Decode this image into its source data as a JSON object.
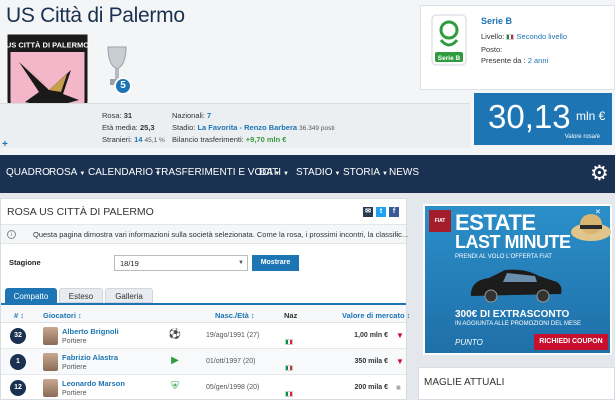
{
  "club": {
    "name": "US Città di Palermo",
    "crest_text": "US CITTÀ DI PALERMO",
    "trophy_count": "5"
  },
  "stats": {
    "squad_label": "Rosa:",
    "squad_value": "31",
    "age_label": "Età media:",
    "age_value": "25,3",
    "foreign_label": "Stranieri:",
    "foreign_value": "14",
    "foreign_pct": "45,1 %",
    "national_label": "Nazionali:",
    "national_value": "7",
    "stadium_label": "Stadio:",
    "stadium_value": "La Favorita - Renzo Barbera",
    "stadium_seats": "36.349 posti",
    "balance_label": "Bilancio trasferimenti:",
    "balance_value": "+9,70 mln €"
  },
  "league": {
    "name": "Serie B",
    "logo_text": "Serie B",
    "level_label": "Livello:",
    "level_value": "Secondo livello",
    "position_label": "Posto:",
    "since_label": "Presente da :",
    "since_value": "2 anni"
  },
  "market_value": {
    "amount": "30,13",
    "unit": "mln €",
    "label": "Valore rosa/e"
  },
  "nav": {
    "items": [
      {
        "label": "QUADRO",
        "caret": false
      },
      {
        "label": "ROSA",
        "caret": true
      },
      {
        "label": "CALENDARIO",
        "caret": true
      },
      {
        "label": "TRASFERIMENTI E VOCI",
        "caret": true
      },
      {
        "label": "DATI",
        "caret": true
      },
      {
        "label": "STADIO",
        "caret": true
      },
      {
        "label": "STORIA",
        "caret": true
      },
      {
        "label": "NEWS",
        "caret": false
      }
    ],
    "gear_icon": "gear-icon"
  },
  "squad": {
    "title": "ROSA US CITTÀ DI PALERMO",
    "info_text": "Questa pagina dimostra vari informazioni sulla società selezionata. Come la rosa, i prossimi incontri, la classific...",
    "season_label": "Stagione",
    "season_value": "18/19",
    "show_button": "Mostrare",
    "tabs": [
      "Compatto",
      "Esteso",
      "Galleria"
    ],
    "headers": {
      "num": "#",
      "player": "Giocatori",
      "birth": "Nasc./Età",
      "nat": "Naz",
      "value": "Valore di mercato"
    },
    "players": [
      {
        "num": "32",
        "name": "Alberto Brignoli",
        "position": "Portiere",
        "birth": "19/ago/1991 (27)",
        "value": "1,00 mln €",
        "trend": "down"
      },
      {
        "num": "1",
        "name": "Fabrizio Alastra",
        "position": "Portiere",
        "birth": "01/ott/1997 (20)",
        "value": "350 mila €",
        "trend": "down"
      },
      {
        "num": "12",
        "name": "Leonardo Marson",
        "position": "Portiere",
        "birth": "05/gen/1998 (20)",
        "value": "200 mila €",
        "trend": "neutral"
      }
    ]
  },
  "ad": {
    "brand": "FIAT",
    "title1": "ESTATE",
    "title2": "LAST MINUTE",
    "subtitle": "PRENDI AL VOLO L'OFFERTA FIAT",
    "price": "300€ DI EXTRASCONTO",
    "price_sub": "IN AGGIUNTA ALLE PROMOZIONI DEL MESE",
    "model": "PUNTO",
    "button": "RICHIEDI COUPON"
  },
  "side": {
    "title": "MAGLIE ATTUALI"
  },
  "colors": {
    "navy": "#1a3151",
    "accent": "#1d75b3",
    "down": "#c8102e",
    "positive": "#3a9a3a"
  }
}
